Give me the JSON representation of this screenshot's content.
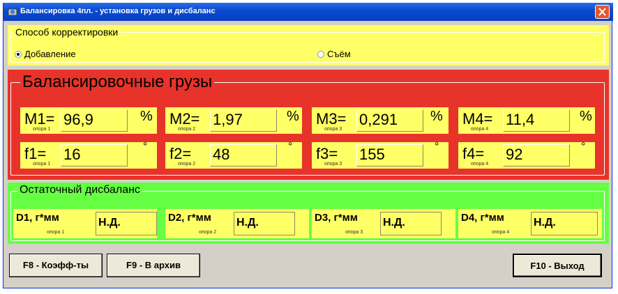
{
  "window": {
    "title": "Балансировка 4пл. - установка грузов и дисбаланс"
  },
  "correction": {
    "legend": "Способ корректировки",
    "options": [
      {
        "label": "Добавление",
        "selected": true
      },
      {
        "label": "Съём",
        "selected": false
      }
    ]
  },
  "weights": {
    "legend": "Балансировочные грузы",
    "mass_unit": "%",
    "angle_unit": "°",
    "masses": [
      {
        "label": "M1=",
        "value": "96,9",
        "support": "опора 1"
      },
      {
        "label": "M2=",
        "value": "1,97",
        "support": "опора 2"
      },
      {
        "label": "M3=",
        "value": "0,291",
        "support": "опора 3"
      },
      {
        "label": "M4=",
        "value": "11,4",
        "support": "опора 4"
      }
    ],
    "angles": [
      {
        "label": "f1=",
        "value": "16",
        "support": "опора 1"
      },
      {
        "label": "f2=",
        "value": "48",
        "support": "опора 2"
      },
      {
        "label": "f3=",
        "value": "155",
        "support": "опора 3"
      },
      {
        "label": "f4=",
        "value": "92",
        "support": "опора 4"
      }
    ]
  },
  "residual": {
    "legend": "Остаточный дисбаланс",
    "items": [
      {
        "label": "D1, г*мм",
        "value": "Н.Д.",
        "support": "опора 1"
      },
      {
        "label": "D2, г*мм",
        "value": "Н.Д.",
        "support": "опора 2"
      },
      {
        "label": "D3, г*мм",
        "value": "Н.Д.",
        "support": "опора 3"
      },
      {
        "label": "D4, г*мм",
        "value": "Н.Д.",
        "support": "опора 4"
      }
    ]
  },
  "buttons": {
    "coeffs": "F8 - Коэфф-ты",
    "archive": "F9 - В архив",
    "exit": "F10 - Выход"
  },
  "colors": {
    "yellow": "#ffff66",
    "red": "#e8332a",
    "green": "#66ff44",
    "titlebar": "#0a4bd0"
  }
}
